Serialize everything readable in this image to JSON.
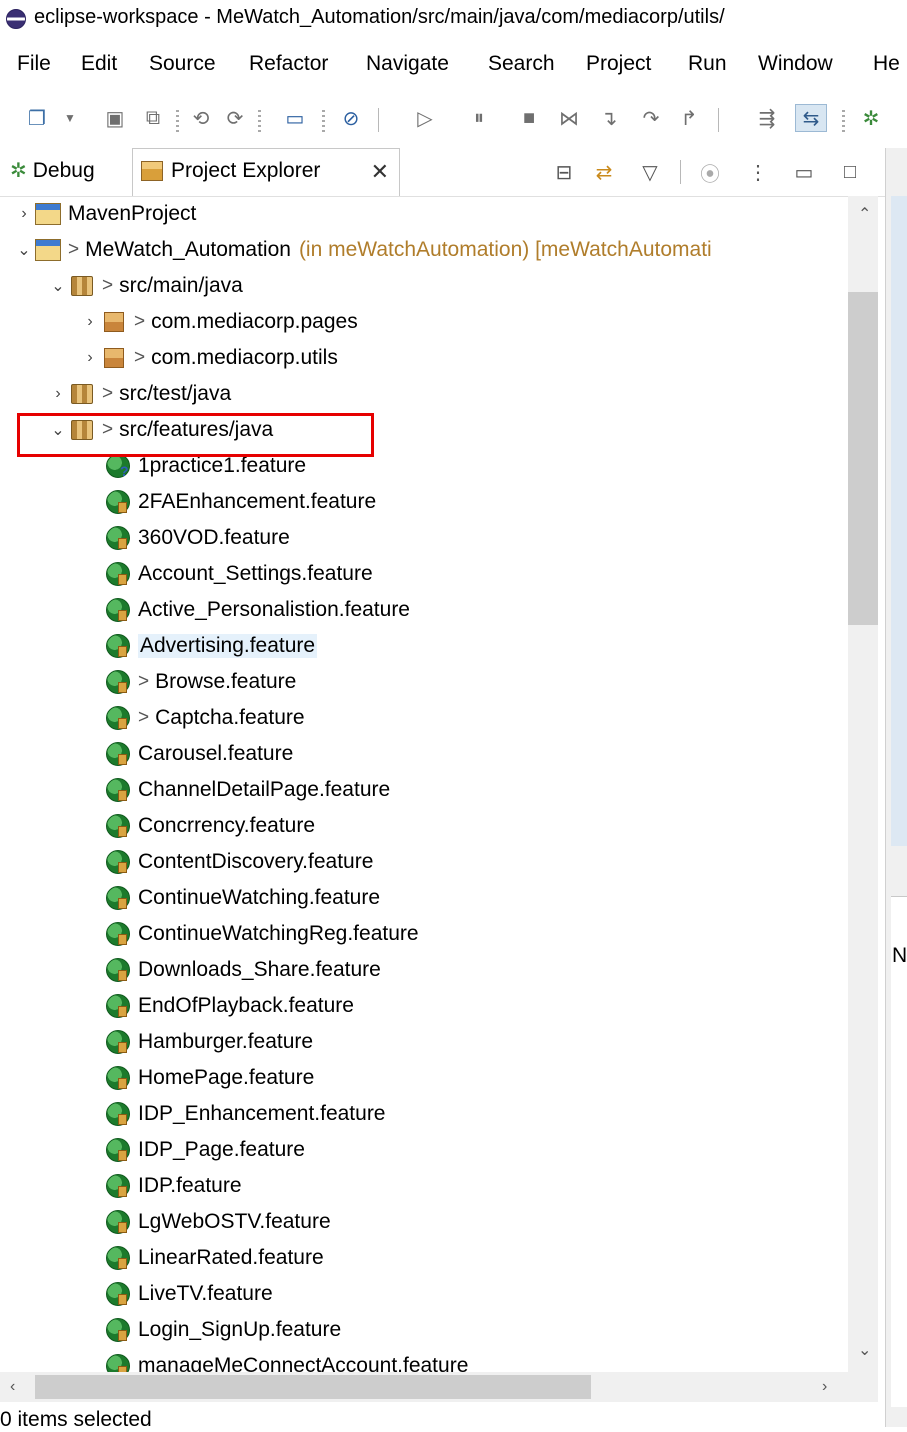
{
  "window": {
    "title": "eclipse-workspace - MeWatch_Automation/src/main/java/com/mediacorp/utils/"
  },
  "menu": [
    "File",
    "Edit",
    "Source",
    "Refactor",
    "Navigate",
    "Search",
    "Project",
    "Run",
    "Window",
    "He"
  ],
  "view_tabs": {
    "debug": "Debug",
    "project_explorer": "Project Explorer",
    "close_glyph": "✕"
  },
  "tree": {
    "maven_project": "MavenProject",
    "mewatch": {
      "prefix": ">",
      "name": "MeWatch_Automation",
      "decoration": "(in meWatchAutomation) [meWatchAutomati"
    },
    "src_main": "src/main/java",
    "pkg_pages": "com.mediacorp.pages",
    "pkg_utils": "com.mediacorp.utils",
    "src_test": "src/test/java",
    "src_features": "src/features/java",
    "files": [
      "1practice1.feature",
      "2FAEnhancement.feature",
      "360VOD.feature",
      "Account_Settings.feature",
      "Active_Personalistion.feature",
      "Advertising.feature",
      "Browse.feature",
      "Captcha.feature",
      "Carousel.feature",
      "ChannelDetailPage.feature",
      "Concrrency.feature",
      "ContentDiscovery.feature",
      "ContinueWatching.feature",
      "ContinueWatchingReg.feature",
      "Downloads_Share.feature",
      "EndOfPlayback.feature",
      "Hamburger.feature",
      "HomePage.feature",
      "IDP_Enhancement.feature",
      "IDP_Page.feature",
      "IDP.feature",
      "LgWebOSTV.feature",
      "LinearRated.feature",
      "LiveTV.feature",
      "Login_SignUp.feature",
      "manageMeConnectAccount.feature"
    ]
  },
  "right_panel_letter": "N",
  "status_bar": "0 items selected"
}
